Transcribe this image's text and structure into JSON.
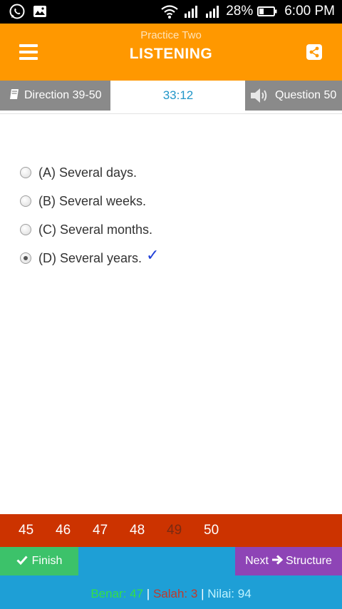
{
  "status_bar": {
    "battery": "28%",
    "time": "6:00 PM"
  },
  "app_bar": {
    "subtitle": "Practice Two",
    "title": "LISTENING"
  },
  "info_bar": {
    "direction_label": "Direction 39-50",
    "timer": "33:12",
    "question_label": "Question 50"
  },
  "options": [
    {
      "label": "(A) Several days.",
      "selected": false
    },
    {
      "label": "(B) Several weeks.",
      "selected": false
    },
    {
      "label": "(C) Several months.",
      "selected": false
    },
    {
      "label": "(D) Several years.",
      "selected": true
    }
  ],
  "question_numbers": [
    "45",
    "46",
    "47",
    "48",
    "49",
    "50"
  ],
  "current_number": "49",
  "bottom": {
    "finish_label": "Finish",
    "next_label": "Next",
    "next_target": "Structure",
    "benar": "Benar: 47",
    "salah": "Salah: 3",
    "nilai": "Nilai: 94",
    "separator": "|"
  },
  "colors": {
    "app_bar": "#FF9800",
    "number_strip": "#CC3300",
    "bottom_bar": "#1E9FD6",
    "finish": "#3CC26A",
    "next": "#8E44B6",
    "checkmark": "#1F3FD8"
  }
}
